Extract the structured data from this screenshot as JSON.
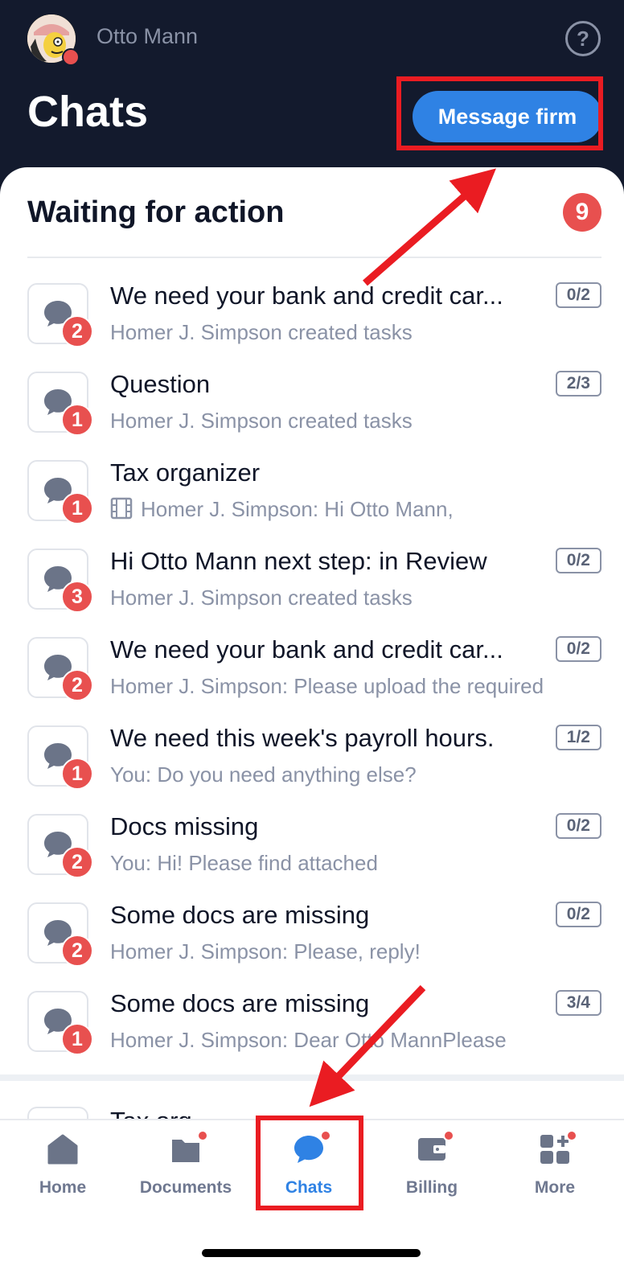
{
  "header": {
    "user_name": "Otto Mann",
    "page_title": "Chats",
    "message_button_label": "Message firm",
    "help_icon": "help-circle-icon"
  },
  "section": {
    "title": "Waiting for action",
    "count": "9"
  },
  "chats": [
    {
      "title": "We need your bank and credit car...",
      "subtitle": "Homer J. Simpson created tasks",
      "unread": "2",
      "tasks": "0/2",
      "attachment": false
    },
    {
      "title": "Question",
      "subtitle": "Homer J. Simpson created tasks",
      "unread": "1",
      "tasks": "2/3",
      "attachment": false
    },
    {
      "title": "Tax organizer",
      "subtitle": "Homer J. Simpson: Hi Otto Mann,",
      "unread": "1",
      "tasks": "",
      "attachment": true
    },
    {
      "title": "Hi Otto Mann next step: in Review",
      "subtitle": "Homer J. Simpson created tasks",
      "unread": "3",
      "tasks": "0/2",
      "attachment": false
    },
    {
      "title": "We need your bank and credit car...",
      "subtitle": "Homer J. Simpson: Please upload the required",
      "unread": "2",
      "tasks": "0/2",
      "attachment": false
    },
    {
      "title": "We need this week's payroll hours.",
      "subtitle": "You: Do you need anything else?",
      "unread": "1",
      "tasks": "1/2",
      "attachment": false
    },
    {
      "title": "Docs missing",
      "subtitle": "You: Hi! Please find attached",
      "unread": "2",
      "tasks": "0/2",
      "attachment": false
    },
    {
      "title": "Some docs are missing",
      "subtitle": "Homer J. Simpson: Please, reply!",
      "unread": "2",
      "tasks": "0/2",
      "attachment": false
    },
    {
      "title": "Some docs are missing",
      "subtitle": "Homer J. Simpson: Dear Otto MannPlease",
      "unread": "1",
      "tasks": "3/4",
      "attachment": false
    }
  ],
  "partial_next_item": {
    "title": "Tax org"
  },
  "tabs": [
    {
      "label": "Home",
      "icon": "home-icon",
      "dot": false,
      "active": false
    },
    {
      "label": "Documents",
      "icon": "folder-icon",
      "dot": true,
      "active": false
    },
    {
      "label": "Chats",
      "icon": "chat-bubble-icon",
      "dot": true,
      "active": true
    },
    {
      "label": "Billing",
      "icon": "wallet-icon",
      "dot": true,
      "active": false
    },
    {
      "label": "More",
      "icon": "grid-plus-icon",
      "dot": true,
      "active": false
    }
  ],
  "colors": {
    "header_bg": "#131a2d",
    "accent": "#2f82e4",
    "badge_red": "#e8504f",
    "annotation_red": "#ea1c22"
  }
}
